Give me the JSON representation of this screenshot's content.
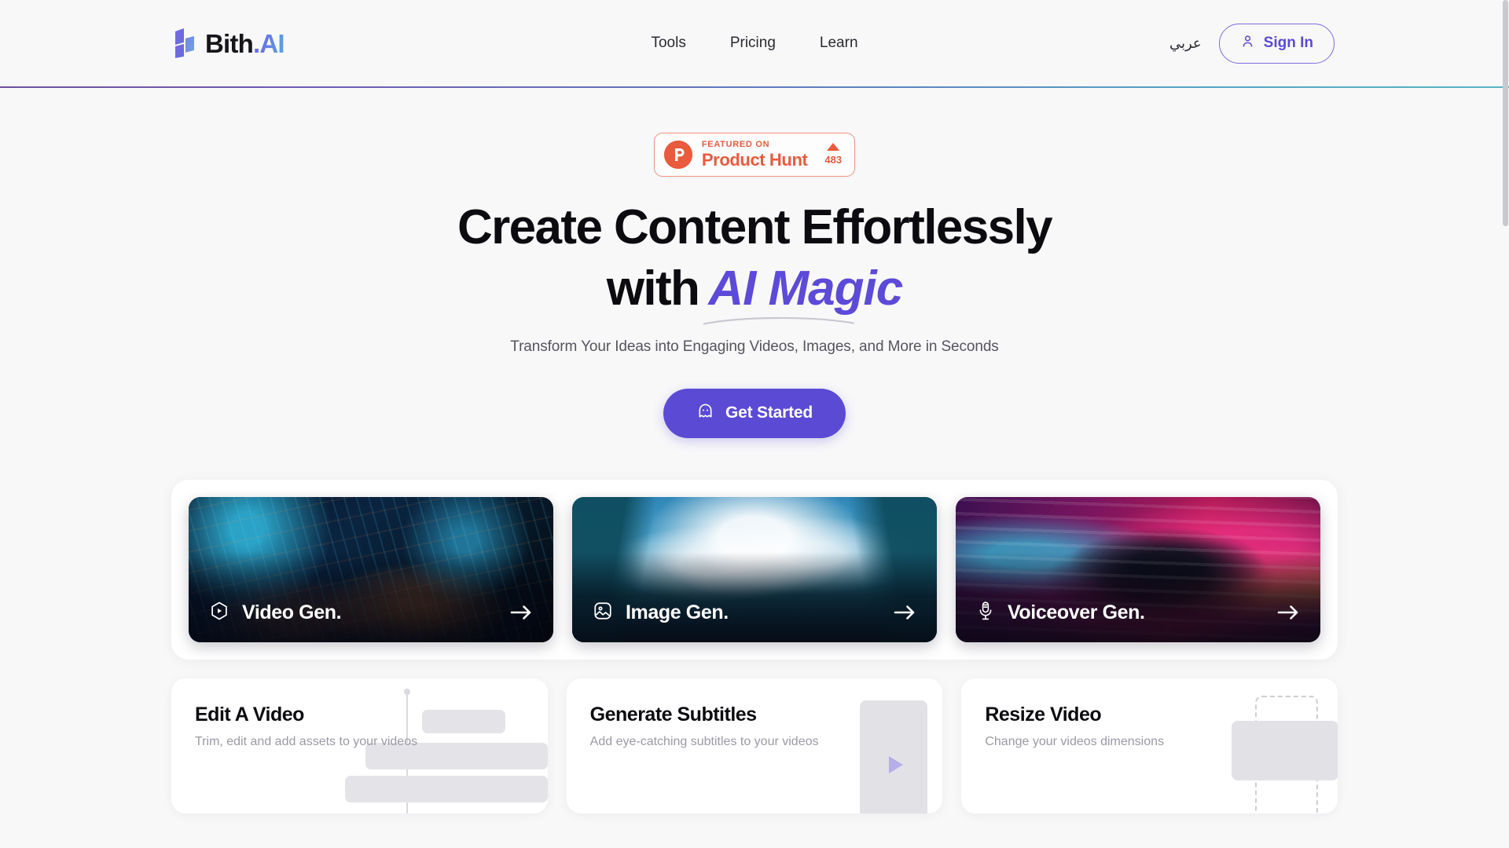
{
  "brand": {
    "name_dark": "Bith",
    "name_accent": ".AI",
    "logo_icon": "bith-logo-icon",
    "gradient_from": "#6c5ce7",
    "gradient_to": "#5aa7e0"
  },
  "nav": {
    "items": [
      {
        "label": "Tools",
        "name": "tools"
      },
      {
        "label": "Pricing",
        "name": "pricing"
      },
      {
        "label": "Learn",
        "name": "learn"
      }
    ]
  },
  "header_right": {
    "language_label": "عربي",
    "signin_label": "Sign In",
    "signin_icon": "user-icon",
    "accent": "#5b4bd4"
  },
  "product_hunt": {
    "kicker": "FEATURED ON",
    "name": "Product Hunt",
    "votes": "483",
    "logo_icon": "product-hunt-icon",
    "caret_icon": "caret-up-icon",
    "color": "#ea5a3d"
  },
  "hero": {
    "headline_line1": "Create Content Effortlessly",
    "headline_line2_prefix": "with",
    "headline_highlight": "AI Magic",
    "highlight_color": "#5c4ad8",
    "subtitle": "Transform Your Ideas into Engaging Videos, Images, and More in Seconds",
    "cta_label": "Get Started",
    "cta_icon": "ghost-icon",
    "cta_color": "#5a4ad4"
  },
  "gen_cards": [
    {
      "label": "Video Gen.",
      "icon": "play-hexagon-icon",
      "arrow_icon": "arrow-right-icon",
      "name": "video-gen"
    },
    {
      "label": "Image Gen.",
      "icon": "image-icon",
      "arrow_icon": "arrow-right-icon",
      "name": "image-gen"
    },
    {
      "label": "Voiceover Gen.",
      "icon": "microphone-icon",
      "arrow_icon": "arrow-right-icon",
      "name": "voiceover-gen"
    }
  ],
  "feature_cards": [
    {
      "title": "Edit A Video",
      "subtitle": "Trim, edit and add assets to your videos",
      "art": "timeline-illustration",
      "name": "edit-a-video"
    },
    {
      "title": "Generate Subtitles",
      "subtitle": "Add eye-catching subtitles to your videos",
      "art": "video-frame-illustration",
      "name": "generate-subtitles"
    },
    {
      "title": "Resize Video",
      "subtitle": "Change your videos dimensions",
      "art": "crop-frame-illustration",
      "name": "resize-video"
    }
  ]
}
